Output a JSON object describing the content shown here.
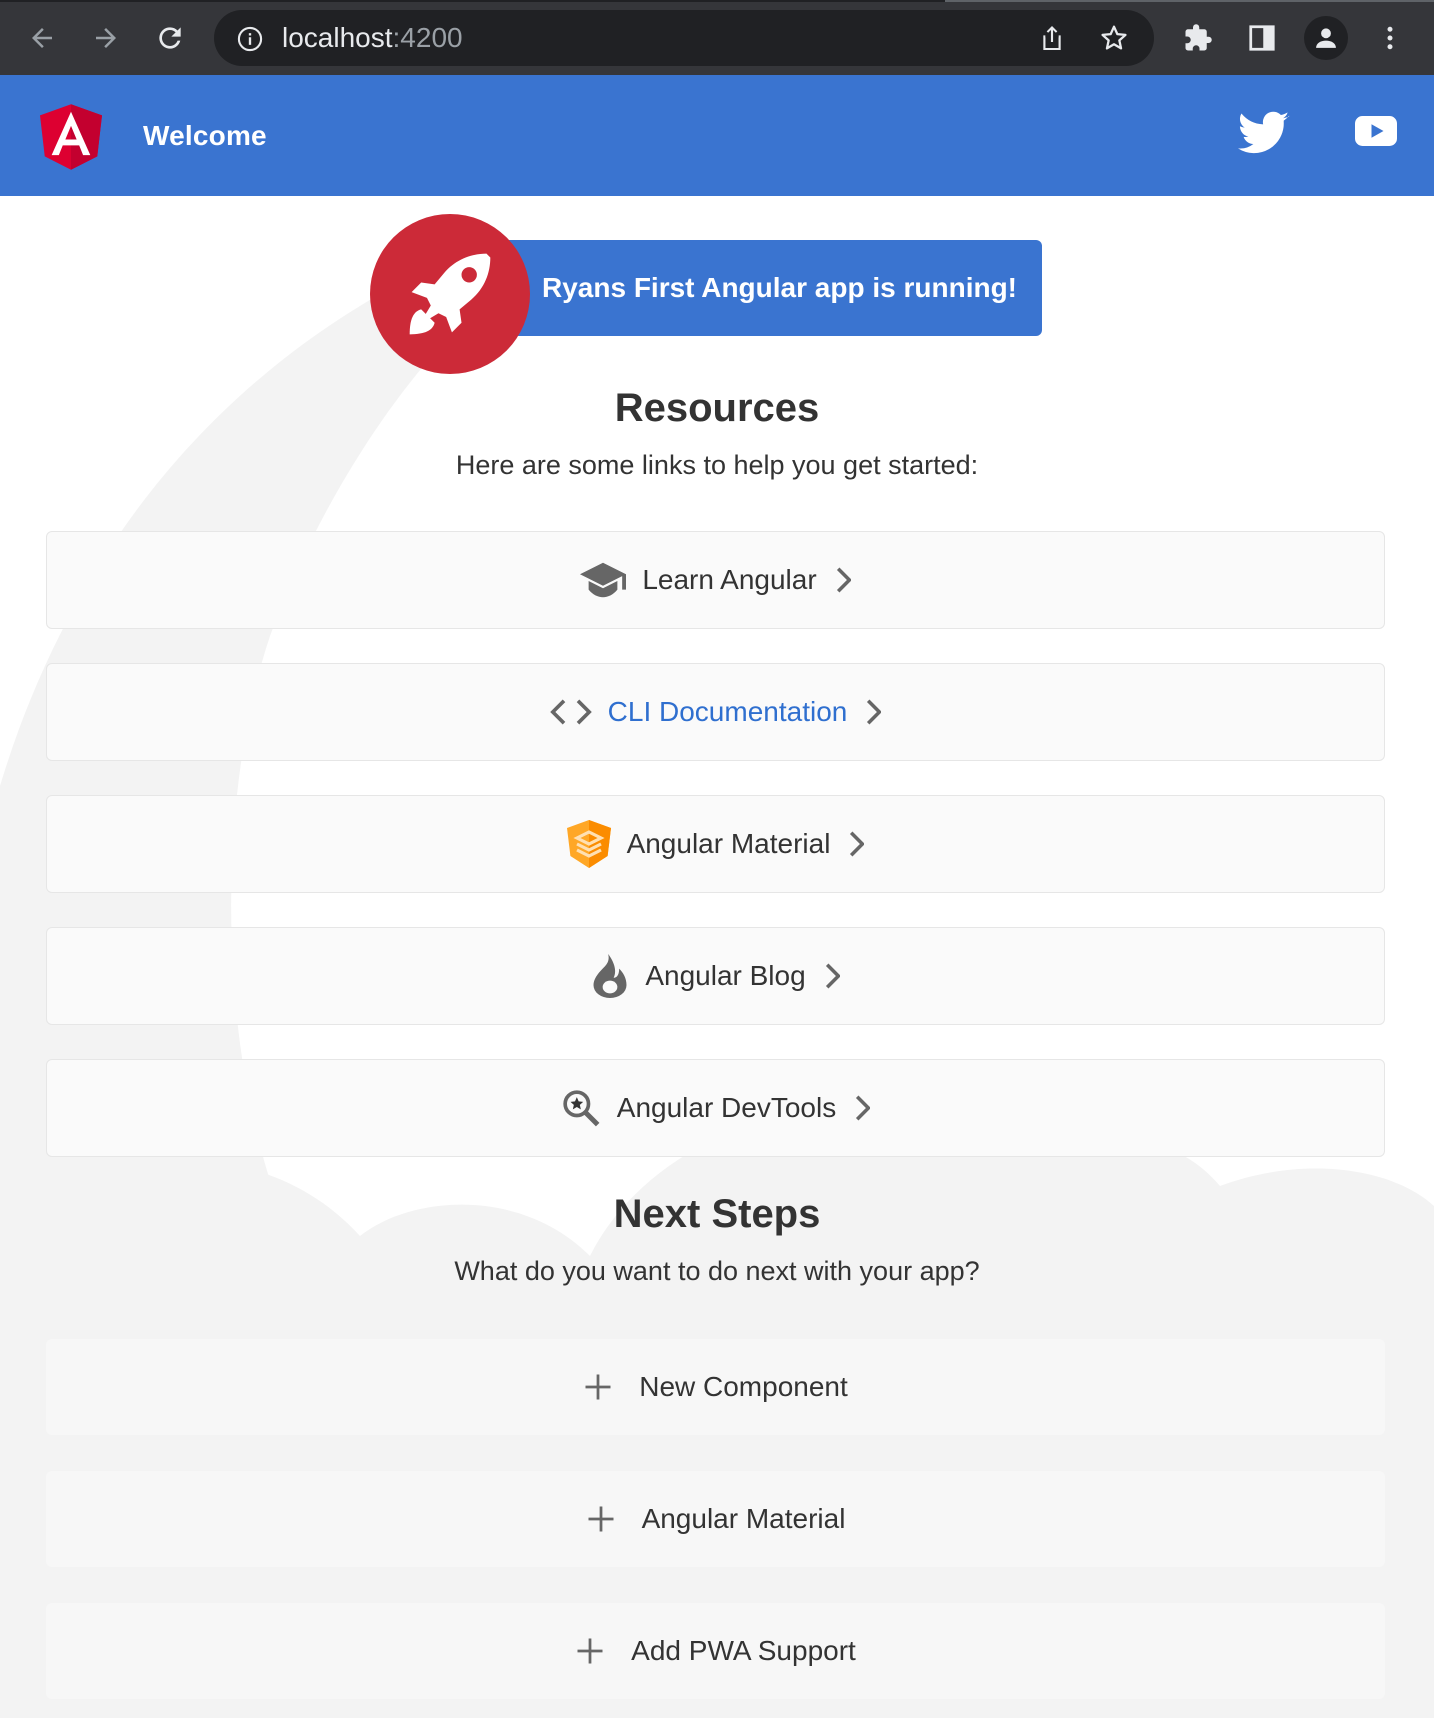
{
  "browser": {
    "url_host": "localhost",
    "url_port": ":4200"
  },
  "toolbar": {
    "title": "Welcome"
  },
  "banner": {
    "text": "Ryans First Angular app is running!"
  },
  "resources": {
    "title": "Resources",
    "subtitle": "Here are some links to help you get started:",
    "items": [
      {
        "label": "Learn Angular",
        "icon": "graduation-cap-icon"
      },
      {
        "label": "CLI Documentation",
        "icon": "code-brackets-icon"
      },
      {
        "label": "Angular Material",
        "icon": "angular-material-icon"
      },
      {
        "label": "Angular Blog",
        "icon": "flame-icon"
      },
      {
        "label": "Angular DevTools",
        "icon": "devtools-magnifier-icon"
      }
    ]
  },
  "next_steps": {
    "title": "Next Steps",
    "subtitle": "What do you want to do next with your app?",
    "items": [
      {
        "label": "New Component",
        "icon": "plus-icon"
      },
      {
        "label": "Angular Material",
        "icon": "plus-icon"
      },
      {
        "label": "Add PWA Support",
        "icon": "plus-icon"
      }
    ]
  },
  "colors": {
    "brand_blue": "#3a74d0",
    "angular_red": "#cc2a38",
    "chrome_dark": "#35363a",
    "link_blue": "#2f6fcf"
  }
}
